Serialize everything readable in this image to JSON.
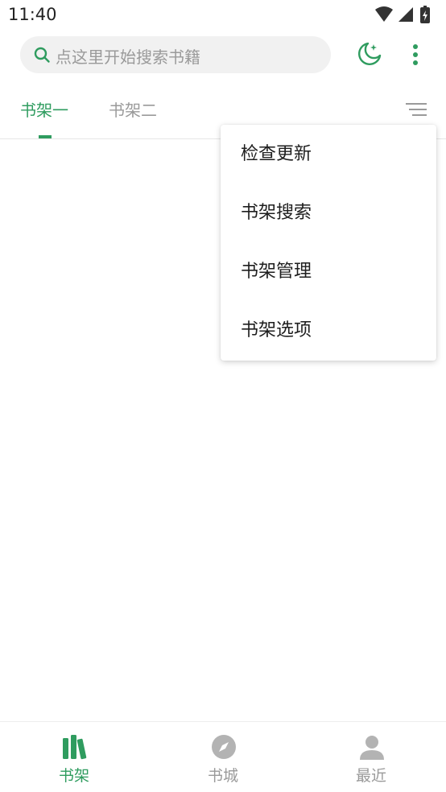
{
  "status_bar": {
    "time": "11:40"
  },
  "search": {
    "placeholder": "点这里开始搜索书籍"
  },
  "header": {
    "icons": [
      "search-icon",
      "night-mode-icon",
      "more-vertical-icon"
    ]
  },
  "tabs": [
    {
      "label": "书架一",
      "selected": true
    },
    {
      "label": "书架二",
      "selected": false
    }
  ],
  "popup_menu": {
    "items": [
      {
        "label": "检查更新"
      },
      {
        "label": "书架搜索"
      },
      {
        "label": "书架管理"
      },
      {
        "label": "书架选项"
      }
    ]
  },
  "bottom_nav": {
    "items": [
      {
        "label": "书架",
        "icon": "bookshelf-icon",
        "selected": true
      },
      {
        "label": "书城",
        "icon": "compass-icon",
        "selected": false
      },
      {
        "label": "最近",
        "icon": "person-icon",
        "selected": false
      }
    ]
  },
  "colors": {
    "accent": "#2f9c5f",
    "inactive": "#9a9a9a",
    "search_bg": "#f1f1f1"
  }
}
